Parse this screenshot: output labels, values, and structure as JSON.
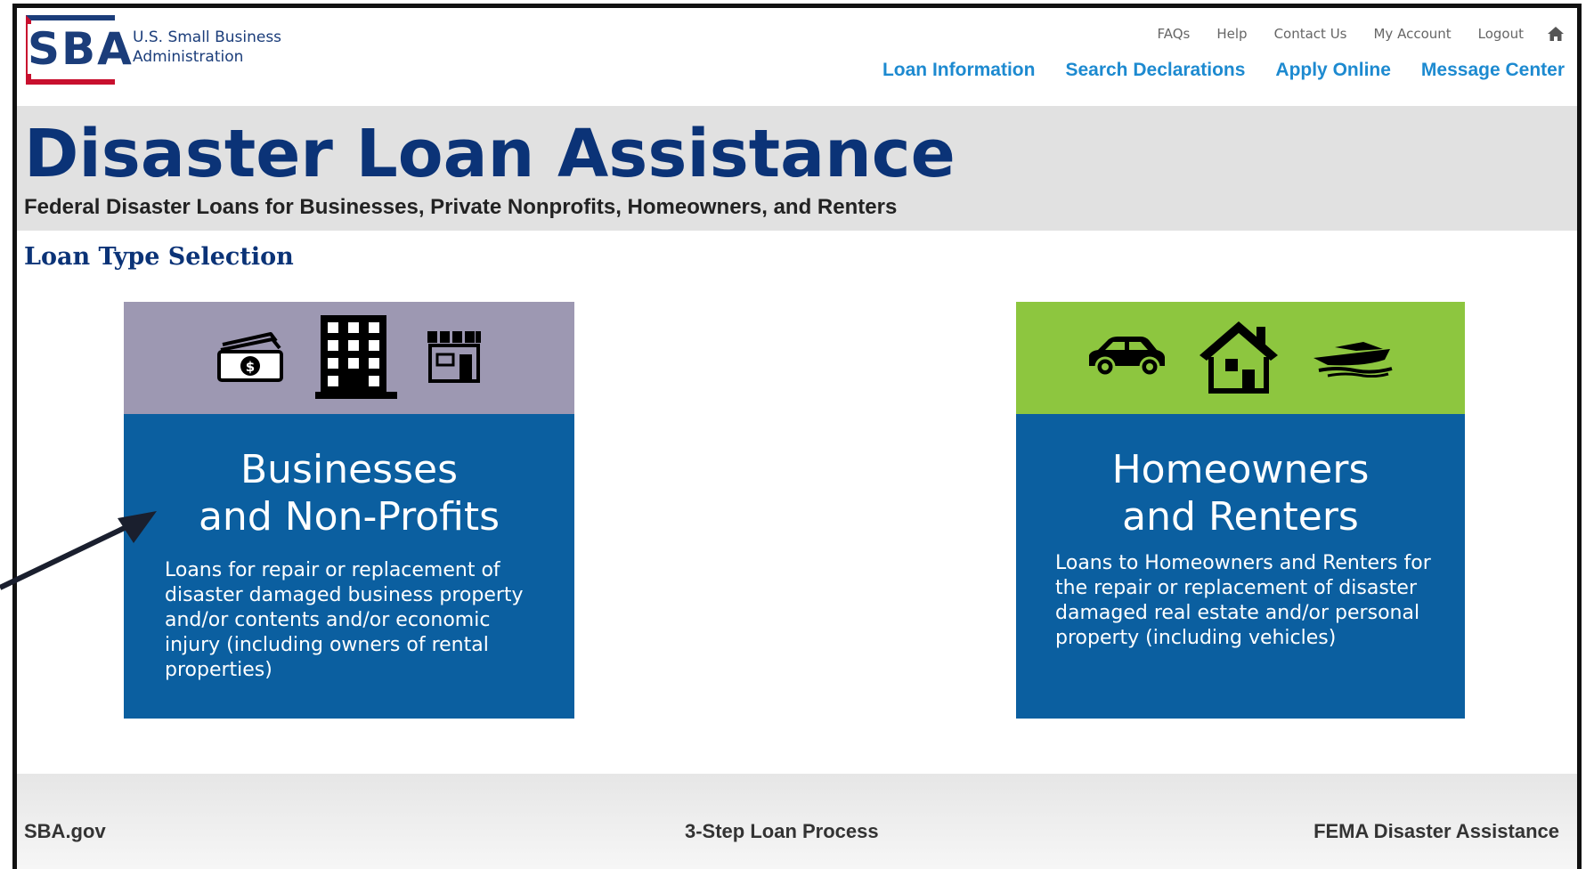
{
  "header": {
    "logo_text": "SBA",
    "agency_name_line1": "U.S. Small Business",
    "agency_name_line2": "Administration",
    "utility_links": [
      "FAQs",
      "Help",
      "Contact Us",
      "My Account",
      "Logout"
    ],
    "home_icon": "home-icon",
    "main_nav": [
      "Loan Information",
      "Search Declarations",
      "Apply Online",
      "Message Center"
    ]
  },
  "title_band": {
    "title": "Disaster Loan Assistance",
    "subtitle": "Federal Disaster Loans for Businesses, Private Nonprofits, Homeowners, and Renters"
  },
  "section_heading": "Loan Type Selection",
  "cards": [
    {
      "title_line1": "Businesses",
      "title_line2": "and Non-Profits",
      "description": "Loans for repair or replacement of disaster damaged business property and/or contents and/or economic injury (including owners of rental properties)",
      "icons": [
        "money-icon",
        "office-building-icon",
        "storefront-icon"
      ],
      "top_color": "#9d98b2"
    },
    {
      "title_line1": "Homeowners",
      "title_line2": "and Renters",
      "description": "Loans to Homeowners and Renters for the repair or replacement of disaster damaged real estate and/or personal property (including vehicles)",
      "icons": [
        "car-icon",
        "house-icon",
        "boat-icon"
      ],
      "top_color": "#8dc63f"
    }
  ],
  "footer": {
    "left": "SBA.gov",
    "center": "3-Step Loan Process",
    "right": "FEMA Disaster Assistance"
  },
  "colors": {
    "brand_navy": "#0b3377",
    "card_blue": "#0b5fa0",
    "nav_link": "#1d8ad0"
  }
}
